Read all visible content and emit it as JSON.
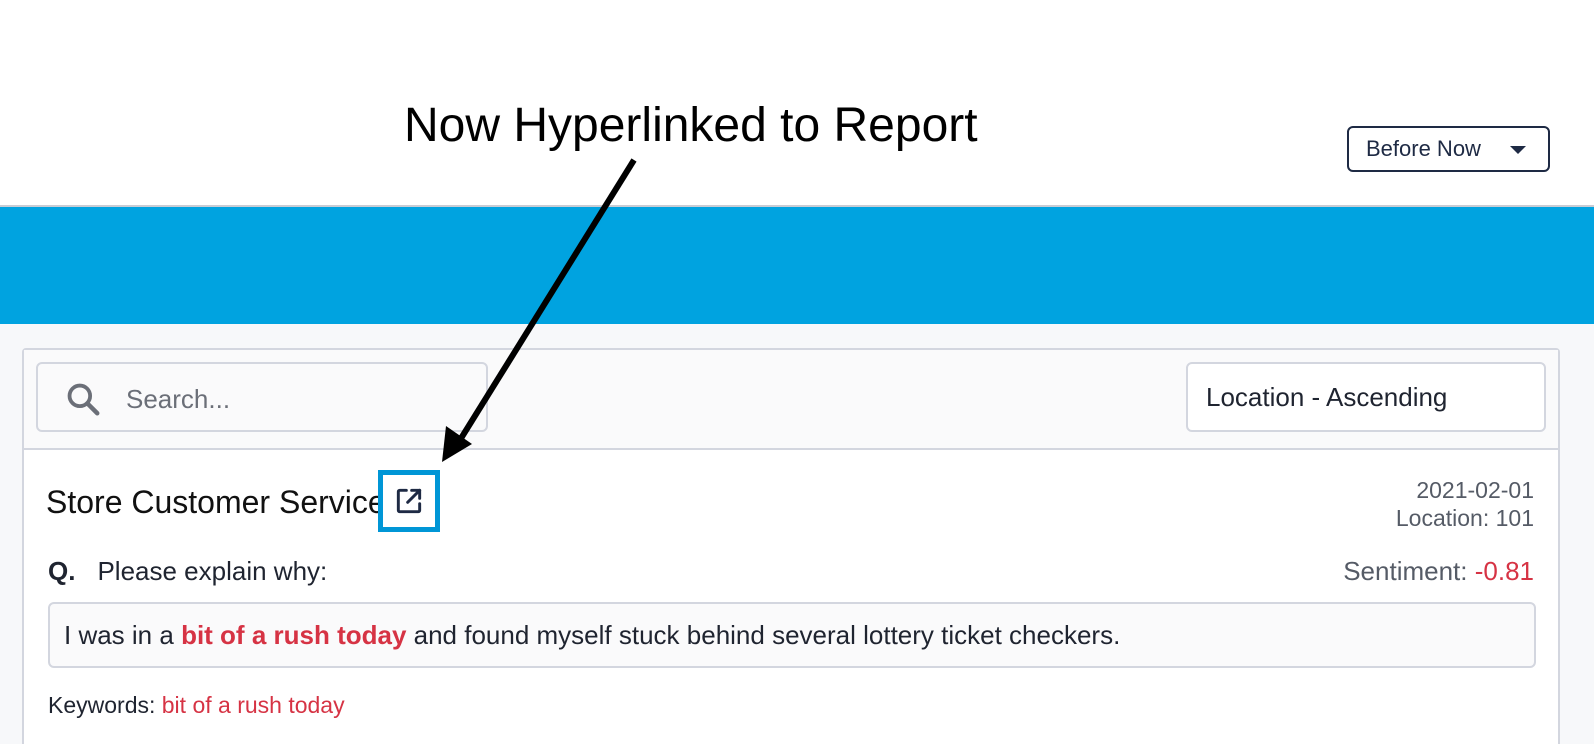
{
  "annotation": {
    "title": "Now Hyperlinked to Report"
  },
  "header": {
    "range_select": "Before Now"
  },
  "toolbar": {
    "search_placeholder": "Search...",
    "sort_select": "Location - Ascending"
  },
  "card": {
    "title": "Store Customer Service",
    "date": "2021-02-01",
    "location": "Location: 101",
    "question_label": "Q.",
    "question_text": "Please explain why:",
    "sentiment_label": "Sentiment: ",
    "sentiment_value": "-0.81",
    "answer_pre": "I was in a ",
    "answer_highlight": "bit of a rush today",
    "answer_post": " and found myself stuck behind several lottery ticket checkers.",
    "keywords_label": "Keywords: ",
    "keywords_value": "bit of a rush today"
  },
  "colors": {
    "brand_blue": "#00a3e0",
    "highlight_red": "#d63344",
    "link_box_blue": "#0096d6"
  },
  "icons": {
    "search": "search-icon",
    "external_link": "external-link-icon",
    "dropdown": "caret-down-icon"
  }
}
